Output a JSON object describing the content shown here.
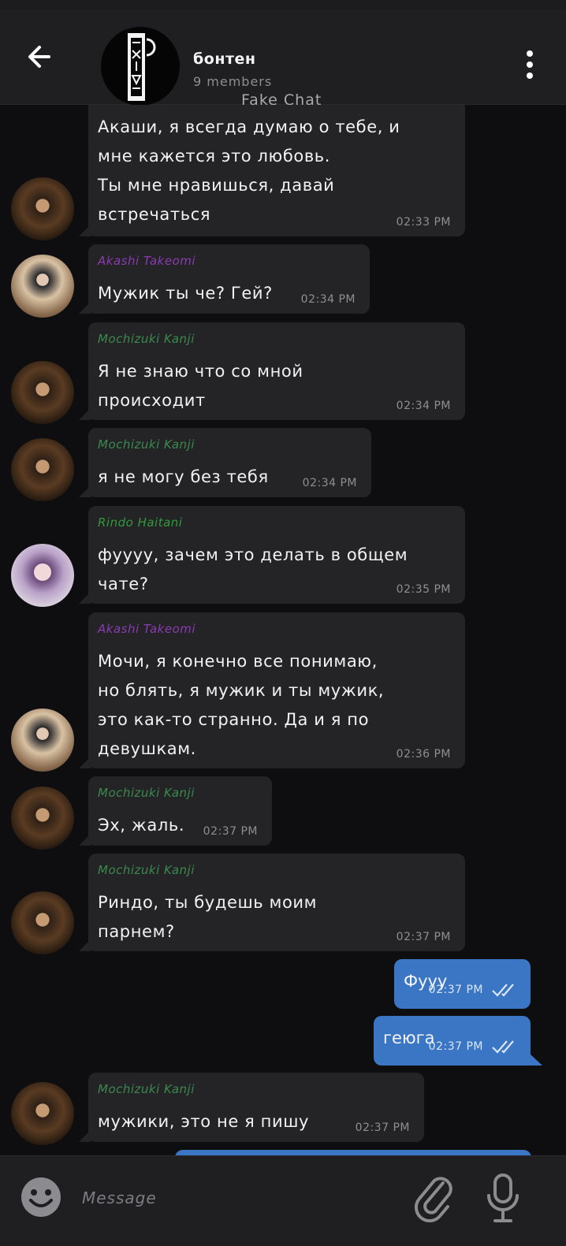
{
  "header": {
    "title": "бонтен",
    "subtitle": "9 members",
    "watermark": "Fake Chat"
  },
  "colors": {
    "akashi": "#8a3bb0",
    "mochizuki": "#3a8a4e",
    "rindo": "#2f9a3a",
    "outgoing": "#3a76c4",
    "incoming": "#242427"
  },
  "messages": [
    {
      "text": "Акаши, я всегда думаю о тебе, и\nмне кажется это любовь.\nТы мне нравишься, давай\nвстречаться",
      "time": "02:33 PM"
    },
    {
      "sender": "Akashi Takeomi",
      "text": "Мужик ты че? Гей?",
      "time": "02:34 PM"
    },
    {
      "sender": "Mochizuki Kanji",
      "text": "Я не знаю что со мной\nпроисходит",
      "time": "02:34 PM"
    },
    {
      "sender": "Mochizuki Kanji",
      "text": "я не могу без тебя",
      "time": "02:34 PM"
    },
    {
      "sender": "Rindo Haitani",
      "text": "фуууу, зачем это делать в общем\nчате?",
      "time": "02:35 PM"
    },
    {
      "sender": "Akashi Takeomi",
      "text": "Мочи, я конечно все понимаю,\nно блять, я мужик и ты мужик,\nэто как-то странно. Да и я по\nдевушкам.",
      "time": "02:36 PM"
    },
    {
      "sender": "Mochizuki Kanji",
      "text": "Эх, жаль.",
      "time": "02:37 PM"
    },
    {
      "sender": "Mochizuki Kanji",
      "text": "Риндо, ты будешь моим\nпарнем?",
      "time": "02:37 PM"
    },
    {
      "text": "Фууу",
      "time": "02:37 PM"
    },
    {
      "text": "геюга",
      "time": "02:37 PM"
    },
    {
      "sender": "Mochizuki Kanji",
      "text": "мужики, это не я пишу",
      "time": "02:37 PM"
    }
  ],
  "composer": {
    "placeholder": "Message"
  }
}
